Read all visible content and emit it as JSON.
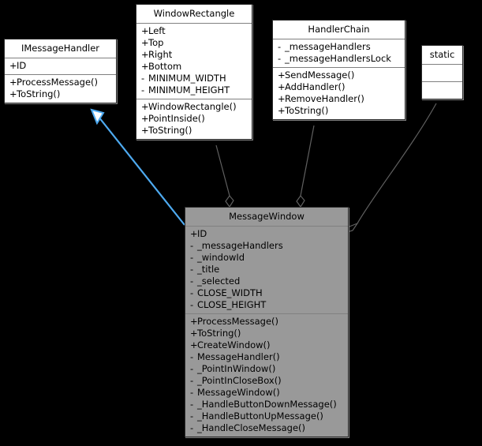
{
  "diagram": {
    "kind": "uml-class-diagram",
    "background_color": "#000000",
    "box_fill_color": "#ffffff",
    "shaded_box_fill_color": "#999999",
    "border_color": "#2a2a2a",
    "divider_color": "#808080",
    "inheritance_edge_color": "#4eaaf0",
    "association_edge_color": "#606060",
    "text_color": "#000000"
  },
  "classes": {
    "imessagehandler": {
      "name": "IMessageHandler",
      "attributes": [
        {
          "visibility": "+",
          "label": "ID"
        }
      ],
      "operations": [
        {
          "visibility": "+",
          "label": "ProcessMessage()"
        },
        {
          "visibility": "+",
          "label": "ToString()"
        }
      ]
    },
    "windowrectangle": {
      "name": "WindowRectangle",
      "attributes": [
        {
          "visibility": "+",
          "label": "Left"
        },
        {
          "visibility": "+",
          "label": "Top"
        },
        {
          "visibility": "+",
          "label": "Right"
        },
        {
          "visibility": "+",
          "label": "Bottom"
        },
        {
          "visibility": "-",
          "label": "MINIMUM_WIDTH"
        },
        {
          "visibility": "-",
          "label": "MINIMUM_HEIGHT"
        }
      ],
      "operations": [
        {
          "visibility": "+",
          "label": "WindowRectangle()"
        },
        {
          "visibility": "+",
          "label": "PointInside()"
        },
        {
          "visibility": "+",
          "label": "ToString()"
        }
      ]
    },
    "handlerchain": {
      "name": "HandlerChain",
      "attributes": [
        {
          "visibility": "-",
          "label": "_messageHandlers"
        },
        {
          "visibility": "-",
          "label": "_messageHandlersLock"
        }
      ],
      "operations": [
        {
          "visibility": "+",
          "label": "SendMessage()"
        },
        {
          "visibility": "+",
          "label": "AddHandler()"
        },
        {
          "visibility": "+",
          "label": "RemoveHandler()"
        },
        {
          "visibility": "+",
          "label": "ToString()"
        }
      ]
    },
    "static": {
      "name": "static",
      "attributes": [],
      "operations": []
    },
    "messagewindow": {
      "name": "MessageWindow",
      "attributes": [
        {
          "visibility": "+",
          "label": "ID"
        },
        {
          "visibility": "-",
          "label": "_messageHandlers"
        },
        {
          "visibility": "-",
          "label": "_windowId"
        },
        {
          "visibility": "-",
          "label": "_title"
        },
        {
          "visibility": "-",
          "label": "_selected"
        },
        {
          "visibility": "-",
          "label": "CLOSE_WIDTH"
        },
        {
          "visibility": "-",
          "label": "CLOSE_HEIGHT"
        }
      ],
      "operations": [
        {
          "visibility": "+",
          "label": "ProcessMessage()"
        },
        {
          "visibility": "+",
          "label": "ToString()"
        },
        {
          "visibility": "+",
          "label": "CreateWindow()"
        },
        {
          "visibility": "-",
          "label": "MessageHandler()"
        },
        {
          "visibility": "-",
          "label": "_PointInWindow()"
        },
        {
          "visibility": "-",
          "label": "_PointInCloseBox()"
        },
        {
          "visibility": "-",
          "label": "MessageWindow()"
        },
        {
          "visibility": "-",
          "label": "_HandleButtonDownMessage()"
        },
        {
          "visibility": "-",
          "label": "_HandleButtonUpMessage()"
        },
        {
          "visibility": "-",
          "label": "_HandleCloseMessage()"
        }
      ]
    }
  },
  "relationships": [
    {
      "id": "inheritance-messagewindow-imessagehandler",
      "type": "inheritance",
      "from": "MessageWindow",
      "to": "IMessageHandler",
      "color": "#4eaaf0",
      "arrowhead": "hollow-triangle"
    },
    {
      "id": "aggregation-windowrectangle-messagewindow",
      "type": "aggregation",
      "from": "WindowRectangle",
      "to": "MessageWindow",
      "color": "#606060",
      "arrowhead": "hollow-diamond"
    },
    {
      "id": "aggregation-handlerchain-messagewindow",
      "type": "aggregation",
      "from": "HandlerChain",
      "to": "MessageWindow",
      "color": "#606060",
      "arrowhead": "hollow-diamond"
    },
    {
      "id": "aggregation-static-messagewindow",
      "type": "aggregation",
      "from": "static",
      "to": "MessageWindow",
      "color": "#606060",
      "arrowhead": "hollow-diamond"
    }
  ]
}
